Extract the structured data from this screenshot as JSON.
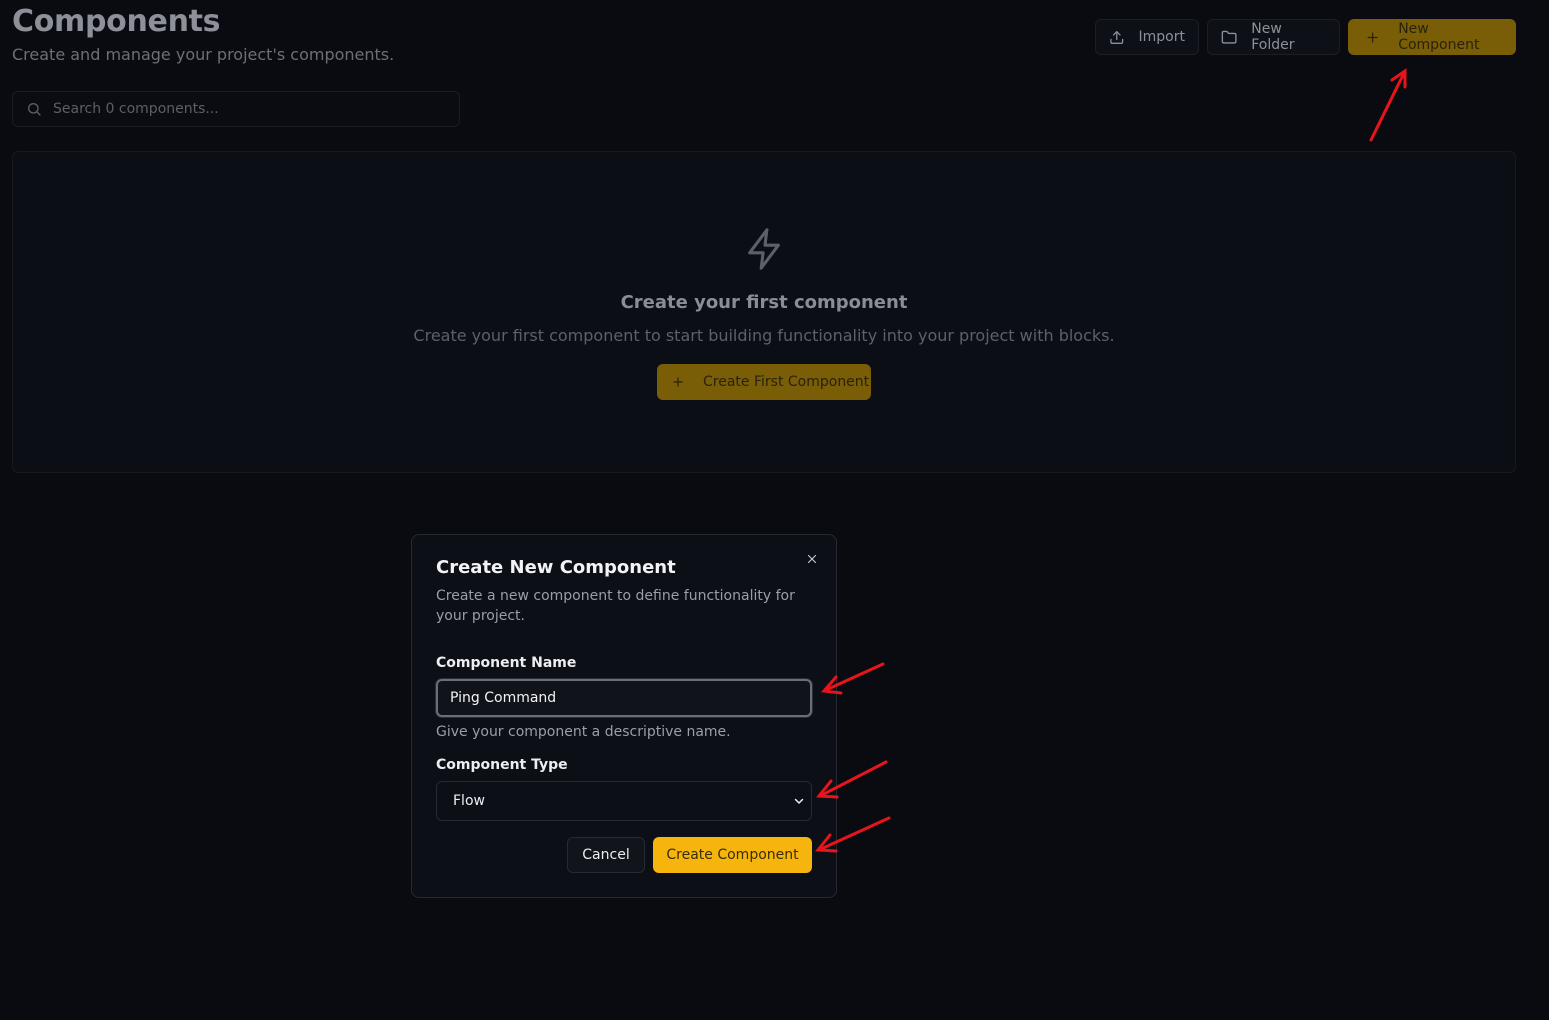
{
  "header": {
    "title": "Components",
    "subtitle": "Create and manage your project's components.",
    "import_label": "Import",
    "new_folder_label": "New Folder",
    "new_component_label": "New Component"
  },
  "search": {
    "placeholder": "Search 0 components..."
  },
  "empty_state": {
    "title": "Create your first component",
    "description": "Create your first component to start building functionality into your project with blocks.",
    "button_label": "Create First Component"
  },
  "modal": {
    "title": "Create New Component",
    "description": "Create a new component to define functionality for your project.",
    "name_label": "Component Name",
    "name_value": "Ping Command",
    "name_hint": "Give your component a descriptive name.",
    "type_label": "Component Type",
    "type_value": "Flow",
    "cancel_label": "Cancel",
    "create_label": "Create Component"
  },
  "colors": {
    "accent": "#f5b50c",
    "annotation": "#e8141b"
  }
}
